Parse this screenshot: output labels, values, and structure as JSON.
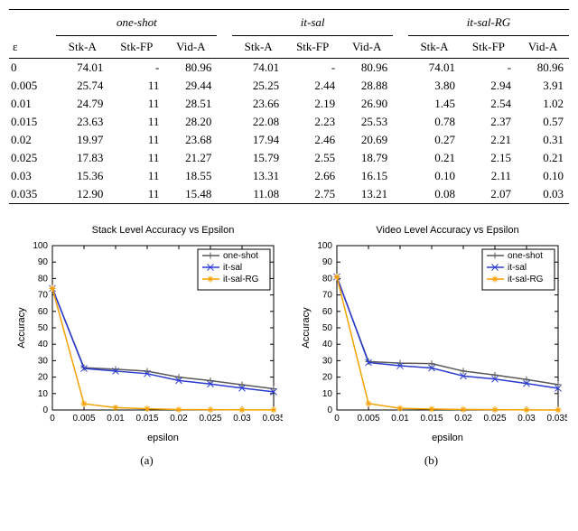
{
  "table": {
    "epsilon_header": "ε",
    "groups": [
      "one-shot",
      "it-sal",
      "it-sal-RG"
    ],
    "columns": [
      "Stk-A",
      "Stk-FP",
      "Vid-A"
    ],
    "rows": [
      {
        "eps": "0",
        "vals": [
          "74.01",
          "-",
          "80.96",
          "74.01",
          "-",
          "80.96",
          "74.01",
          "-",
          "80.96"
        ]
      },
      {
        "eps": "0.005",
        "vals": [
          "25.74",
          "11",
          "29.44",
          "25.25",
          "2.44",
          "28.88",
          "3.80",
          "2.94",
          "3.91"
        ]
      },
      {
        "eps": "0.01",
        "vals": [
          "24.79",
          "11",
          "28.51",
          "23.66",
          "2.19",
          "26.90",
          "1.45",
          "2.54",
          "1.02"
        ]
      },
      {
        "eps": "0.015",
        "vals": [
          "23.63",
          "11",
          "28.20",
          "22.08",
          "2.23",
          "25.53",
          "0.78",
          "2.37",
          "0.57"
        ]
      },
      {
        "eps": "0.02",
        "vals": [
          "19.97",
          "11",
          "23.68",
          "17.94",
          "2.46",
          "20.69",
          "0.27",
          "2.21",
          "0.31"
        ]
      },
      {
        "eps": "0.025",
        "vals": [
          "17.83",
          "11",
          "21.27",
          "15.79",
          "2.55",
          "18.79",
          "0.21",
          "2.15",
          "0.21"
        ]
      },
      {
        "eps": "0.03",
        "vals": [
          "15.36",
          "11",
          "18.55",
          "13.31",
          "2.66",
          "16.15",
          "0.10",
          "2.11",
          "0.10"
        ]
      },
      {
        "eps": "0.035",
        "vals": [
          "12.90",
          "11",
          "15.48",
          "11.08",
          "2.75",
          "13.21",
          "0.08",
          "2.07",
          "0.03"
        ]
      }
    ]
  },
  "chart_data": [
    {
      "id": "chart-a",
      "type": "line",
      "title": "Stack Level Accuracy vs Epsilon",
      "xlabel": "epsilon",
      "ylabel": "Accuracy",
      "xlim": [
        0,
        0.035
      ],
      "ylim": [
        0,
        100
      ],
      "xticks": [
        0,
        0.005,
        0.01,
        0.015,
        0.02,
        0.025,
        0.03,
        0.035
      ],
      "yticks": [
        0,
        10,
        20,
        30,
        40,
        50,
        60,
        70,
        80,
        90,
        100
      ],
      "caption": "(a)",
      "legend": [
        "one-shot",
        "it-sal",
        "it-sal-RG"
      ],
      "series": [
        {
          "name": "one-shot",
          "color": "#595959",
          "marker": "plus",
          "x": [
            0,
            0.005,
            0.01,
            0.015,
            0.02,
            0.025,
            0.03,
            0.035
          ],
          "y": [
            74.01,
            25.74,
            24.79,
            23.63,
            19.97,
            17.83,
            15.36,
            12.9
          ]
        },
        {
          "name": "it-sal",
          "color": "#2a3bd1",
          "marker": "x",
          "x": [
            0,
            0.005,
            0.01,
            0.015,
            0.02,
            0.025,
            0.03,
            0.035
          ],
          "y": [
            74.01,
            25.25,
            23.66,
            22.08,
            17.94,
            15.79,
            13.31,
            11.08
          ]
        },
        {
          "name": "it-sal-RG",
          "color": "#f5a100",
          "marker": "star",
          "x": [
            0,
            0.005,
            0.01,
            0.015,
            0.02,
            0.025,
            0.03,
            0.035
          ],
          "y": [
            74.01,
            3.8,
            1.45,
            0.78,
            0.27,
            0.21,
            0.1,
            0.08
          ]
        }
      ]
    },
    {
      "id": "chart-b",
      "type": "line",
      "title": "Video Level Accuracy vs Epsilon",
      "xlabel": "epsilon",
      "ylabel": "Accuracy",
      "xlim": [
        0,
        0.035
      ],
      "ylim": [
        0,
        100
      ],
      "xticks": [
        0,
        0.005,
        0.01,
        0.015,
        0.02,
        0.025,
        0.03,
        0.035
      ],
      "yticks": [
        0,
        10,
        20,
        30,
        40,
        50,
        60,
        70,
        80,
        90,
        100
      ],
      "caption": "(b)",
      "legend": [
        "one-shot",
        "it-sal",
        "it-sal-RG"
      ],
      "series": [
        {
          "name": "one-shot",
          "color": "#595959",
          "marker": "plus",
          "x": [
            0,
            0.005,
            0.01,
            0.015,
            0.02,
            0.025,
            0.03,
            0.035
          ],
          "y": [
            80.96,
            29.44,
            28.51,
            28.2,
            23.68,
            21.27,
            18.55,
            15.48
          ]
        },
        {
          "name": "it-sal",
          "color": "#2a3bd1",
          "marker": "x",
          "x": [
            0,
            0.005,
            0.01,
            0.015,
            0.02,
            0.025,
            0.03,
            0.035
          ],
          "y": [
            80.96,
            28.88,
            26.9,
            25.53,
            20.69,
            18.79,
            16.15,
            13.21
          ]
        },
        {
          "name": "it-sal-RG",
          "color": "#f5a100",
          "marker": "star",
          "x": [
            0,
            0.005,
            0.01,
            0.015,
            0.02,
            0.025,
            0.03,
            0.035
          ],
          "y": [
            80.96,
            3.91,
            1.02,
            0.57,
            0.31,
            0.21,
            0.1,
            0.03
          ]
        }
      ]
    }
  ]
}
